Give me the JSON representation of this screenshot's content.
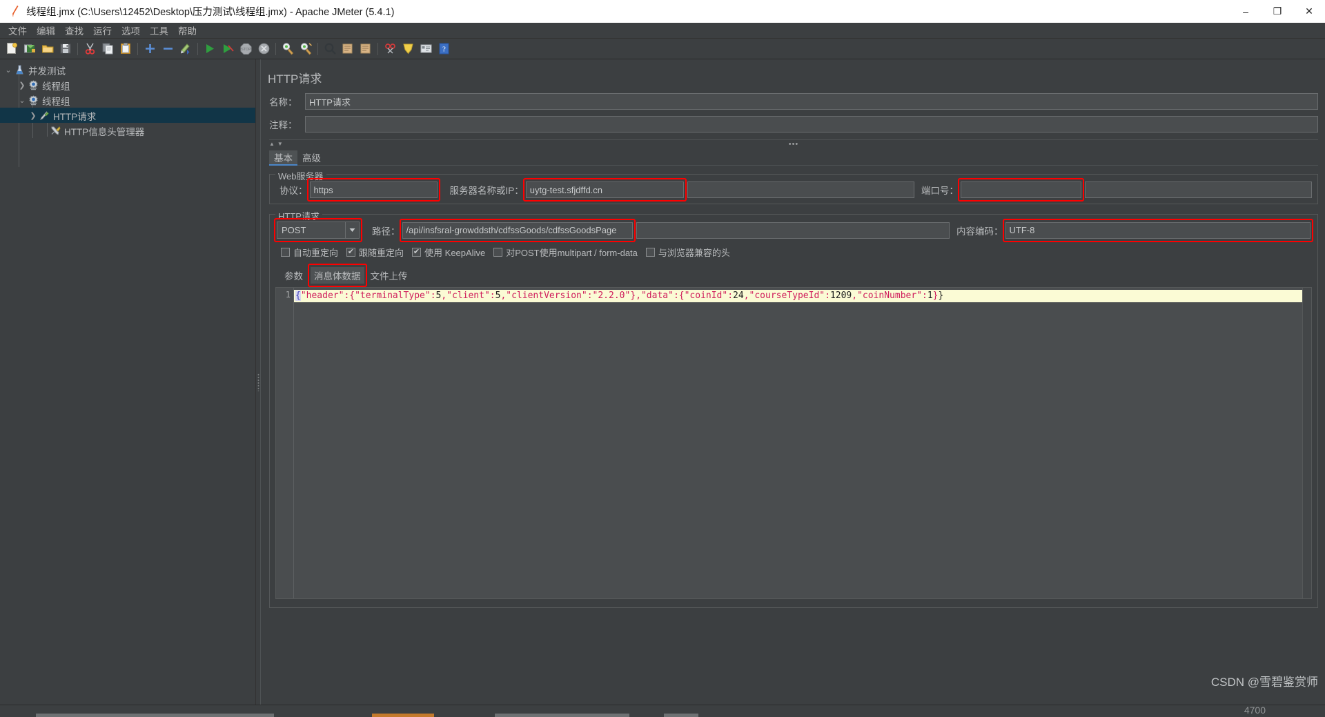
{
  "window": {
    "title": "线程组.jmx (C:\\Users\\12452\\Desktop\\压力测试\\线程组.jmx) - Apache JMeter (5.4.1)",
    "app_icon": "jmeter-feather-icon",
    "minimize": "–",
    "maximize": "❐",
    "close": "✕"
  },
  "menubar": {
    "items": [
      {
        "label": "文件",
        "name": "menu-file"
      },
      {
        "label": "编辑",
        "name": "menu-edit"
      },
      {
        "label": "查找",
        "name": "menu-search"
      },
      {
        "label": "运行",
        "name": "menu-run"
      },
      {
        "label": "选项",
        "name": "menu-options"
      },
      {
        "label": "工具",
        "name": "menu-tools"
      },
      {
        "label": "帮助",
        "name": "menu-help"
      }
    ]
  },
  "toolbar": {
    "buttons": [
      "new-icon",
      "templates-icon",
      "open-icon",
      "save-icon",
      "cut-icon",
      "copy-icon",
      "paste-icon",
      "expand-all-icon",
      "collapse-all-icon",
      "toggle-icon",
      "start-icon",
      "start-no-timers-icon",
      "stop-icon",
      "shutdown-icon",
      "clear-icon",
      "clear-all-icon",
      "search-icon",
      "reset-search-icon",
      "function-helper-icon",
      "help-icon",
      "undo-icon"
    ]
  },
  "tree": {
    "nodes": [
      {
        "label": "并发测试",
        "icon": "test-plan-icon",
        "twisty": "expanded",
        "depth": 0,
        "selected": false
      },
      {
        "label": "线程组",
        "icon": "thread-group-icon",
        "twisty": "collapsed",
        "depth": 1,
        "selected": false
      },
      {
        "label": "线程组",
        "icon": "thread-group-icon",
        "twisty": "expanded",
        "depth": 1,
        "selected": false
      },
      {
        "label": "HTTP请求",
        "icon": "http-sampler-icon",
        "twisty": "collapsed",
        "depth": 2,
        "selected": true
      },
      {
        "label": "HTTP信息头管理器",
        "icon": "header-manager-icon",
        "twisty": "none",
        "depth": 3,
        "selected": false
      }
    ]
  },
  "panel": {
    "title": "HTTP请求",
    "name_label": "名称：",
    "name_value": "HTTP请求",
    "comment_label": "注释：",
    "comment_value": "",
    "collapse_up": "▲",
    "collapse_down": "▼",
    "overflow_dots": "•••",
    "tabs": [
      {
        "label": "基本",
        "name": "tab-basic",
        "active": true
      },
      {
        "label": "高级",
        "name": "tab-advanced",
        "active": false
      }
    ]
  },
  "web_server": {
    "group_title": "Web服务器",
    "protocol_label": "协议：",
    "protocol_value": "https",
    "server_label": "服务器名称或IP：",
    "server_value": "uytg-test.sfjdffd.cn",
    "port_label": "端口号：",
    "port_value": ""
  },
  "http_request": {
    "group_title": "HTTP请求",
    "method_value": "POST",
    "method_arrow": "▼",
    "path_label": "路径：",
    "path_value": "/api/insfsral-growddsth/cdfssGoods/cdfssGoodsPage",
    "encoding_label": "内容编码：",
    "encoding_value": "UTF-8",
    "checkboxes": [
      {
        "label": "自动重定向",
        "checked": false,
        "name": "checkbox-auto-redirect"
      },
      {
        "label": "跟随重定向",
        "checked": true,
        "name": "checkbox-follow-redirect"
      },
      {
        "label": "使用 KeepAlive",
        "checked": true,
        "name": "checkbox-keepalive"
      },
      {
        "label": "对POST使用multipart / form-data",
        "checked": false,
        "name": "checkbox-multipart"
      },
      {
        "label": "与浏览器兼容的头",
        "checked": false,
        "name": "checkbox-browser-compatible-headers"
      }
    ],
    "body_tabs": [
      {
        "label": "参数",
        "name": "tab-parameters",
        "active": false
      },
      {
        "label": "消息体数据",
        "name": "tab-body-data",
        "active": true
      },
      {
        "label": "文件上传",
        "name": "tab-file-upload",
        "active": false
      }
    ]
  },
  "editor": {
    "line_number": "1",
    "body_raw": "{\"header\":{\"terminalType\":5,\"client\":5,\"clientVersion\":\"2.2.0\"},\"data\":{\"coinId\":24,\"courseTypeId\":1209,\"coinNumber\":1}}",
    "tokens": [
      {
        "t": "{",
        "c": "tk-brace"
      },
      {
        "t": "\"header\"",
        "c": "tk-key"
      },
      {
        "t": ":",
        "c": "tk-punct"
      },
      {
        "t": "{",
        "c": "tk-punct"
      },
      {
        "t": "\"terminalType\"",
        "c": "tk-key"
      },
      {
        "t": ":",
        "c": "tk-punct"
      },
      {
        "t": "5",
        "c": "tk-num"
      },
      {
        "t": ",",
        "c": "tk-punct"
      },
      {
        "t": "\"client\"",
        "c": "tk-key"
      },
      {
        "t": ":",
        "c": "tk-punct"
      },
      {
        "t": "5",
        "c": "tk-num"
      },
      {
        "t": ",",
        "c": "tk-punct"
      },
      {
        "t": "\"clientVersion\"",
        "c": "tk-key"
      },
      {
        "t": ":",
        "c": "tk-punct"
      },
      {
        "t": "\"2.2.0\"",
        "c": "tk-str"
      },
      {
        "t": "}",
        "c": "tk-punct"
      },
      {
        "t": ",",
        "c": "tk-punct"
      },
      {
        "t": "\"data\"",
        "c": "tk-key"
      },
      {
        "t": ":",
        "c": "tk-punct"
      },
      {
        "t": "{",
        "c": "tk-punct"
      },
      {
        "t": "\"coinId\"",
        "c": "tk-key"
      },
      {
        "t": ":",
        "c": "tk-punct"
      },
      {
        "t": "24",
        "c": "tk-num"
      },
      {
        "t": ",",
        "c": "tk-punct"
      },
      {
        "t": "\"courseTypeId\"",
        "c": "tk-key"
      },
      {
        "t": ":",
        "c": "tk-punct"
      },
      {
        "t": "1209",
        "c": "tk-num"
      },
      {
        "t": ",",
        "c": "tk-punct"
      },
      {
        "t": "\"coinNumber\"",
        "c": "tk-key"
      },
      {
        "t": ":",
        "c": "tk-punct"
      },
      {
        "t": "1",
        "c": "tk-num"
      },
      {
        "t": "}",
        "c": "tk-punct"
      },
      {
        "t": "}",
        "c": "tk-plain"
      }
    ]
  },
  "watermark": {
    "text": "CSDN @雪碧鉴赏师",
    "text2": "4700"
  },
  "colors": {
    "accent": "#4b86c9",
    "annotation": "#fe0000",
    "selection": "#113547",
    "panel_bg": "#3c3f41",
    "field_bg": "#4a4d4f",
    "editor_line": "#fbfbd5"
  }
}
